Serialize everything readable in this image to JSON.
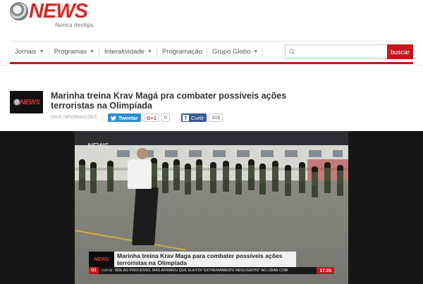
{
  "brand": {
    "logo_text": "NEWS",
    "tagline": "Nunca desliga.",
    "accent_color": "#c4161c"
  },
  "nav": {
    "items": [
      {
        "label": "Jornais",
        "has_dropdown": true
      },
      {
        "label": "Programas",
        "has_dropdown": true
      },
      {
        "label": "Interatividade",
        "has_dropdown": true
      },
      {
        "label": "Programação",
        "has_dropdown": false
      },
      {
        "label": "Grupo Globo",
        "has_dropdown": true
      }
    ],
    "search": {
      "placeholder": "",
      "button_label": "buscar",
      "icon": "search-icon"
    }
  },
  "article": {
    "title": "Marinha treina Krav Magá pra combater possíveis ações terroristas na Olimpíada",
    "more_info": "MAIS INFORMAÇÕES",
    "share": {
      "tweet_label": "Tweetar",
      "gplus_label": "G+1",
      "gplus_count": "0",
      "facebook_label": "Curtir",
      "facebook_count": "319"
    }
  },
  "video": {
    "watermark": "NEWS",
    "lower_third": {
      "logo": "NEWS",
      "headline": "Marinha treina Krav Maga para combater possíveis ações  terroristas na Olimpíada",
      "g1_badge": "G1",
      "site": ".com.br",
      "ticker": "NDE AO PROCESSO, MAS AFIRMOU QUE ELA FOI \"EXTREMAMENTE NEGLIGENTE\" AO LIDAR COM",
      "time": "17:25"
    }
  }
}
